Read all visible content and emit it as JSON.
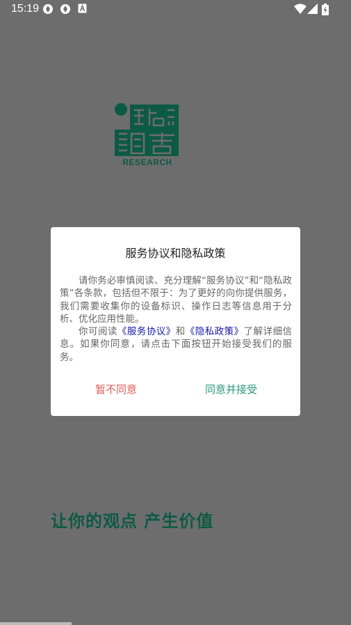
{
  "status_bar": {
    "time": "15:19",
    "icons": [
      "app-notification-icon",
      "app-notification-icon",
      "a-keyboard-icon",
      "wifi-icon",
      "cellular-signal-icon",
      "battery-charging-icon"
    ]
  },
  "logo": {
    "research_text": "RESEARCH",
    "brand_color": "#0d5a44"
  },
  "slogan": "让你的观点 产生价值",
  "dialog": {
    "title": "服务协议和隐私政策",
    "paragraph1": "请你务必审慎阅读、充分理解“服务协议”和“隐私政策”各条款，包括但不限于：为了更好的向你提供服务，我们需要收集你的设备标识、操作日志等信息用于分析、优化应用性能。",
    "p2_prefix": "你可阅读",
    "p2_link1": "《服务协议》",
    "p2_and": "和",
    "p2_link2": "《隐私政策》",
    "p2_suffix": "了解详细信息。如果你同意，请点击下面按钮开始接受我们的服务。",
    "disagree_label": "暂不同意",
    "agree_label": "同意并接受"
  }
}
